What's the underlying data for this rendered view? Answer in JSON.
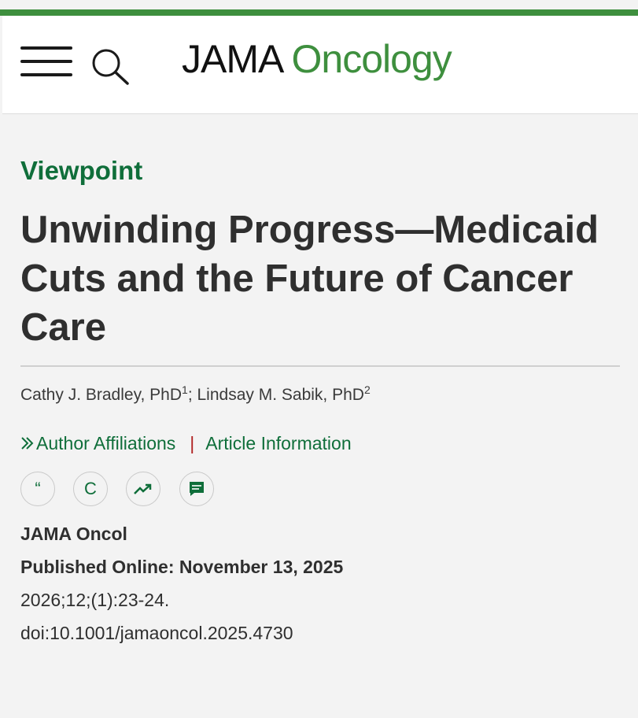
{
  "header": {
    "logo_main": "JAMA",
    "logo_accent": "Oncology"
  },
  "colors": {
    "accent": "#3e8f3e",
    "link": "#0f6e3a",
    "separator": "#b02020"
  },
  "article": {
    "category": "Viewpoint",
    "title": "Unwinding Progress—Medicaid Cuts and the Future of Cancer Care",
    "authors": [
      {
        "name": "Cathy J. Bradley, PhD",
        "sup": "1"
      },
      {
        "name": "Lindsay M. Sabik, PhD",
        "sup": "2"
      }
    ],
    "author_sep": "; ",
    "links": {
      "affiliations": "Author Affiliations",
      "separator": "|",
      "info": "Article Information"
    },
    "tools": [
      {
        "icon": "quote-icon",
        "glyph": "“"
      },
      {
        "icon": "permissions-icon",
        "glyph": "C"
      },
      {
        "icon": "metrics-trend-icon",
        "glyph": ""
      },
      {
        "icon": "comment-icon",
        "glyph": ""
      }
    ],
    "journal": "JAMA Oncol",
    "published": "Published Online: November 13, 2025",
    "citation": "2026;12;(1):23-24.",
    "doi": "doi:10.1001/jamaoncol.2025.4730"
  }
}
